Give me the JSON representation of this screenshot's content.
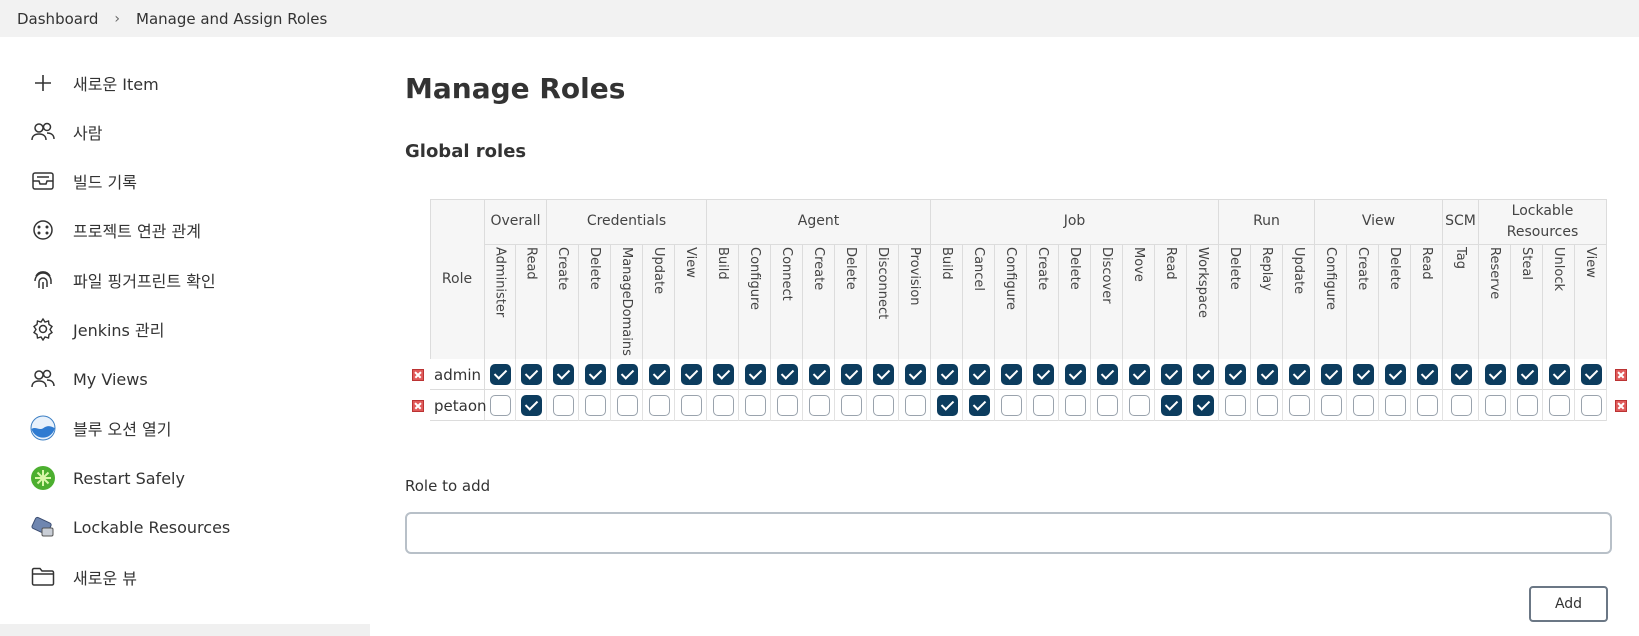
{
  "breadcrumb": {
    "root": "Dashboard",
    "current": "Manage and Assign Roles"
  },
  "sidebar": {
    "items": [
      {
        "label": "새로운 Item",
        "icon": "plus-icon"
      },
      {
        "label": "사람",
        "icon": "people-icon"
      },
      {
        "label": "빌드 기록",
        "icon": "inbox-icon"
      },
      {
        "label": "프로젝트 연관 관계",
        "icon": "relation-icon"
      },
      {
        "label": "파일 핑거프린트 확인",
        "icon": "fingerprint-icon"
      },
      {
        "label": "Jenkins 관리",
        "icon": "gear-icon"
      },
      {
        "label": "My Views",
        "icon": "people-icon"
      },
      {
        "label": "블루 오션 열기",
        "icon": "blue-ocean-icon"
      },
      {
        "label": "Restart Safely",
        "icon": "restart-icon"
      },
      {
        "label": "Lockable Resources",
        "icon": "lockable-resources-icon"
      },
      {
        "label": "새로운 뷰",
        "icon": "folder-icon"
      }
    ]
  },
  "page_title": "Manage Roles",
  "section_title": "Global roles",
  "table": {
    "role_header": "Role",
    "groups": [
      {
        "name": "Overall",
        "perms": [
          "Administer",
          "Read"
        ]
      },
      {
        "name": "Credentials",
        "perms": [
          "Create",
          "Delete",
          "ManageDomains",
          "Update",
          "View"
        ]
      },
      {
        "name": "Agent",
        "perms": [
          "Build",
          "Configure",
          "Connect",
          "Create",
          "Delete",
          "Disconnect",
          "Provision"
        ]
      },
      {
        "name": "Job",
        "perms": [
          "Build",
          "Cancel",
          "Configure",
          "Create",
          "Delete",
          "Discover",
          "Move",
          "Read",
          "Workspace"
        ]
      },
      {
        "name": "Run",
        "perms": [
          "Delete",
          "Replay",
          "Update"
        ]
      },
      {
        "name": "View",
        "perms": [
          "Configure",
          "Create",
          "Delete",
          "Read"
        ]
      },
      {
        "name": "SCM",
        "perms": [
          "Tag"
        ]
      },
      {
        "name": "Lockable Resources",
        "perms": [
          "Reserve",
          "Steal",
          "Unlock",
          "View"
        ]
      }
    ],
    "roles": [
      {
        "name": "admin",
        "checked": [
          1,
          1,
          1,
          1,
          1,
          1,
          1,
          1,
          1,
          1,
          1,
          1,
          1,
          1,
          1,
          1,
          1,
          1,
          1,
          1,
          1,
          1,
          1,
          1,
          1,
          1,
          1,
          1,
          1,
          1,
          1,
          1,
          1,
          1,
          1
        ]
      },
      {
        "name": "petaon",
        "checked": [
          0,
          1,
          0,
          0,
          0,
          0,
          0,
          0,
          0,
          0,
          0,
          0,
          0,
          0,
          1,
          1,
          0,
          0,
          0,
          0,
          0,
          1,
          1,
          0,
          0,
          0,
          0,
          0,
          0,
          0,
          0,
          0,
          0,
          0,
          0
        ]
      }
    ]
  },
  "role_to_add": {
    "label": "Role to add",
    "value": ""
  },
  "add_button": "Add",
  "colors": {
    "checkbox_on": "#0c3c5e",
    "delete_icon": "#e05a5a"
  }
}
